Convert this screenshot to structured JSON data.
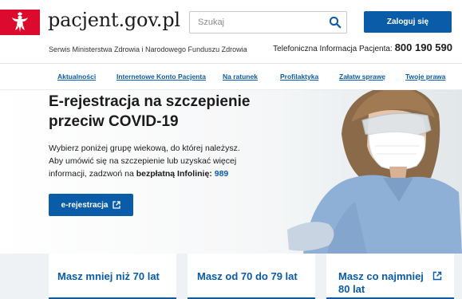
{
  "header": {
    "logo_text": "pacjent.gov.pl",
    "subline": "Serwis Ministerstwa Zdrowia i Narodowego Funduszu Zdrowia",
    "search_placeholder": "Szukaj",
    "login_label": "Zaloguj się",
    "hotline_label": "Telefoniczna Informacja Pacjenta:",
    "hotline_number": "800 190 590"
  },
  "nav": {
    "items": [
      {
        "label": "Aktualności"
      },
      {
        "label": "Internetowe Konto Pacjenta"
      },
      {
        "label": "Na ratunek"
      },
      {
        "label": "Profilaktyka"
      },
      {
        "label": "Załatw sprawę"
      },
      {
        "label": "Twoje prawa"
      }
    ]
  },
  "hero": {
    "title": "E-rejestracja na szczepienie przeciw COVID-19",
    "desc_part1": "Wybierz poniżej grupę wiekową, do której należysz. Aby umówić się na szczepienie lub uzyskać więcej informacji, zadzwoń na ",
    "desc_bold": "bezpłatną Infolinię:",
    "desc_phone": "989",
    "button_label": "e-rejestracja"
  },
  "cards": [
    {
      "label": "Masz mniej niż 70 lat"
    },
    {
      "label": "Masz od 70 do 79 lat"
    },
    {
      "label": "Masz co najmniej 80 lat"
    }
  ],
  "colors": {
    "brand_blue": "#0a5ba8",
    "brand_red": "#dc0a2d"
  }
}
